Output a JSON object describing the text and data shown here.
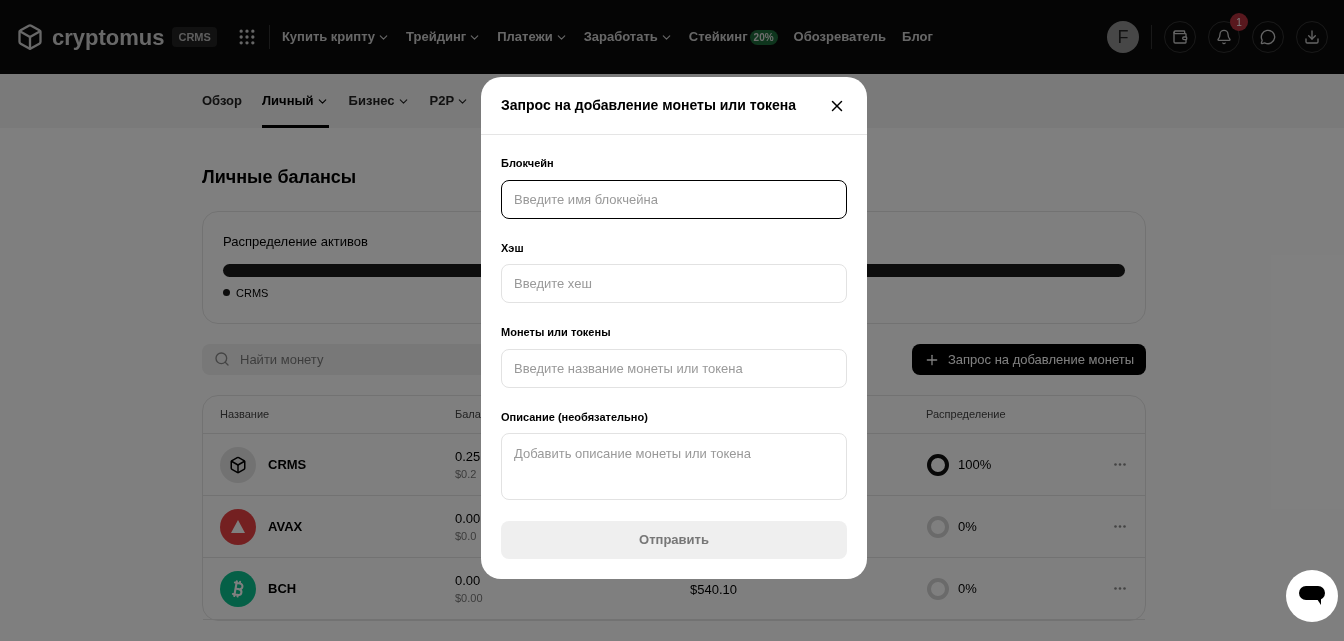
{
  "header": {
    "logo": "cryptomus",
    "logo_badge": "CRMS",
    "nav": [
      {
        "label": "Купить крипту",
        "dropdown": true
      },
      {
        "label": "Трейдинг",
        "dropdown": true
      },
      {
        "label": "Платежи",
        "dropdown": true
      },
      {
        "label": "Заработать",
        "dropdown": true
      },
      {
        "label": "Стейкинг",
        "dropdown": false,
        "badge": "20%"
      },
      {
        "label": "Обозреватель",
        "dropdown": false
      },
      {
        "label": "Блог",
        "dropdown": false
      }
    ],
    "avatar": "F",
    "notification_count": "1"
  },
  "tabs": [
    {
      "label": "Обзор",
      "dropdown": false,
      "selected": false
    },
    {
      "label": "Личный",
      "dropdown": true,
      "selected": true
    },
    {
      "label": "Бизнес",
      "dropdown": true,
      "selected": false
    },
    {
      "label": "P2P",
      "dropdown": true,
      "selected": false
    }
  ],
  "page_title": "Личные балансы",
  "distribution": {
    "title": "Распределение активов",
    "legend": [
      {
        "label": "CRMS",
        "color": "#1a1a1a"
      }
    ]
  },
  "search": {
    "placeholder": "Найти монету"
  },
  "request_button": "Запрос на добавление монеты",
  "table": {
    "columns": [
      "Название",
      "Бала",
      "Распределение"
    ],
    "rows": [
      {
        "name": "CRMS",
        "kind": "cube",
        "balance": "0.25",
        "balance_usd": "$0.2",
        "share": "100%",
        "ring_full": true
      },
      {
        "name": "AVAX",
        "kind": "avax",
        "balance": "0.00",
        "balance_usd": "$0.0",
        "share": "0%",
        "ring_full": false
      },
      {
        "name": "BCH",
        "kind": "bch",
        "balance": "0.00",
        "balance_usd": "$0.00",
        "price": "$540.10",
        "share": "0%",
        "ring_full": false
      }
    ]
  },
  "modal": {
    "title": "Запрос на добавление монеты или токена",
    "fields": [
      {
        "label": "Блокчейн",
        "placeholder": "Введите имя блокчейна",
        "kind": "input",
        "focused": true
      },
      {
        "label": "Хэш",
        "placeholder": "Введите хеш",
        "kind": "input",
        "focused": false
      },
      {
        "label": "Монеты или токены",
        "placeholder": "Введите название монеты или токена",
        "kind": "input",
        "focused": false
      },
      {
        "label": "Описание (необязательно)",
        "placeholder": "Добавить описание монеты или токена",
        "kind": "textarea",
        "focused": false
      }
    ],
    "submit": {
      "label": "Отправить",
      "disabled": true
    }
  }
}
